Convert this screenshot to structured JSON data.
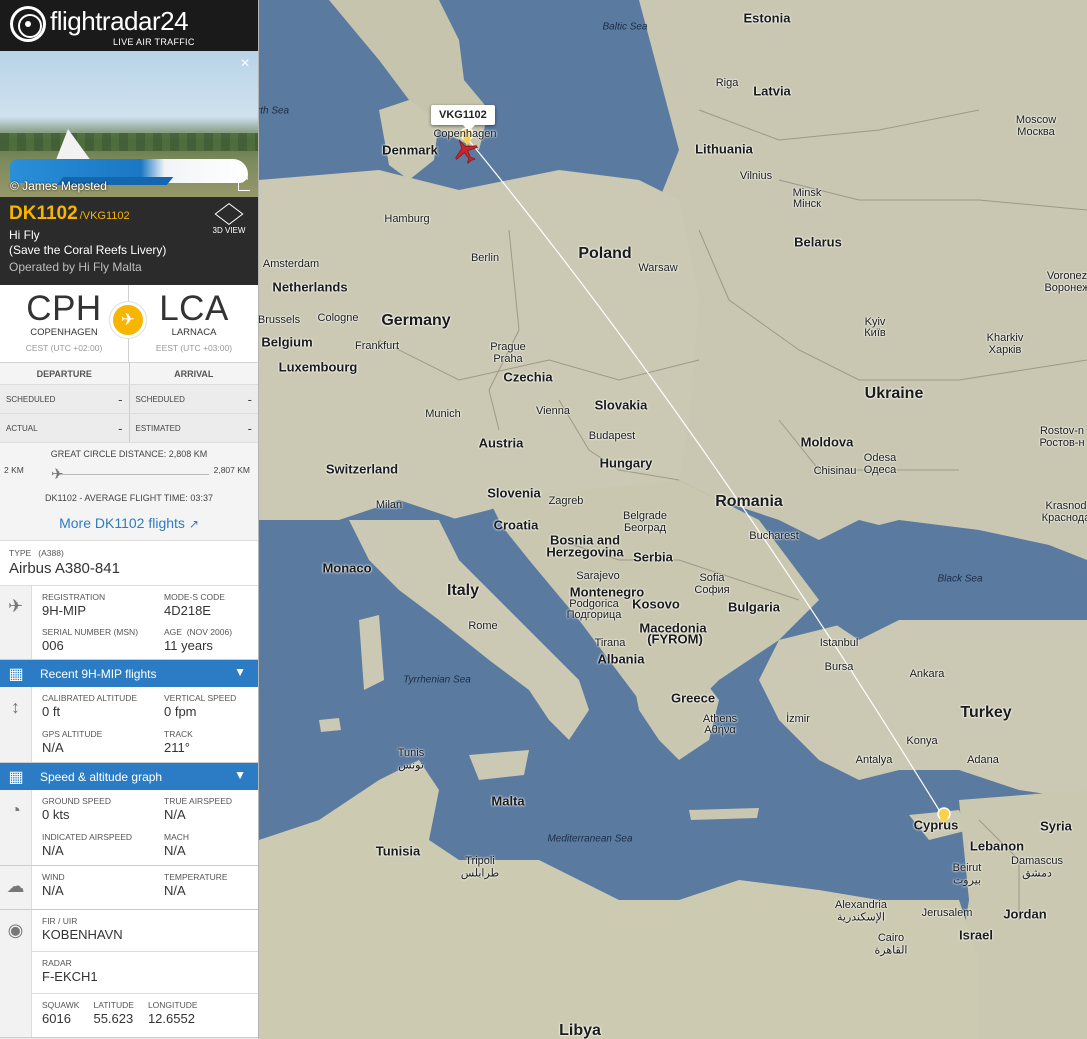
{
  "logo": {
    "brand": "flightradar24",
    "tagline": "LIVE AIR TRAFFIC"
  },
  "photo": {
    "credit": "© James Mepsted",
    "close": "×"
  },
  "flight": {
    "number": "DK1102",
    "callsign": "/VKG1102",
    "airline": "Hi Fly",
    "livery": "(Save the Coral Reefs Livery)",
    "operated_by": "Operated by Hi Fly Malta",
    "view_3d": "3D VIEW"
  },
  "route": {
    "origin": {
      "iata": "CPH",
      "city": "COPENHAGEN",
      "tz": "CEST (UTC +02:00)"
    },
    "destination": {
      "iata": "LCA",
      "city": "LARNACA",
      "tz": "EEST (UTC +03:00)"
    }
  },
  "times": {
    "departure_header": "DEPARTURE",
    "arrival_header": "ARRIVAL",
    "scheduled_label": "SCHEDULED",
    "actual_label": "ACTUAL",
    "estimated_label": "ESTIMATED",
    "dep_scheduled": "-",
    "arr_scheduled": "-",
    "dep_actual": "-",
    "arr_estimated": "-"
  },
  "distance": {
    "label": "GREAT CIRCLE DISTANCE: 2,808 KM",
    "flown": "2 KM",
    "remaining": "2,807 KM",
    "avg_time": "DK1102 - AVERAGE FLIGHT TIME: 03:37",
    "more_flights": "More DK1102 flights",
    "progress": 0.001
  },
  "aircraft": {
    "type_label": "TYPE",
    "type_code": "(A388)",
    "type_name": "Airbus A380-841",
    "registration_label": "REGISTRATION",
    "registration": "9H-MIP",
    "modes_label": "MODE-S CODE",
    "modes": "4D218E",
    "serial_label": "SERIAL NUMBER (MSN)",
    "serial": "006",
    "age_label": "AGE",
    "age_date": "(NOV 2006)",
    "age": "11 years"
  },
  "sections": {
    "recent_flights": "Recent 9H-MIP flights",
    "speed_graph": "Speed & altitude graph"
  },
  "altitude": {
    "cal_alt_label": "CALIBRATED ALTITUDE",
    "cal_alt": "0 ft",
    "vs_label": "VERTICAL SPEED",
    "vs": "0 fpm",
    "gps_label": "GPS ALTITUDE",
    "gps": "N/A",
    "track_label": "TRACK",
    "track": "211°"
  },
  "speed": {
    "gs_label": "GROUND SPEED",
    "gs": "0 kts",
    "tas_label": "TRUE AIRSPEED",
    "tas": "N/A",
    "ias_label": "INDICATED AIRSPEED",
    "ias": "N/A",
    "mach_label": "MACH",
    "mach": "N/A"
  },
  "weather": {
    "wind_label": "WIND",
    "wind": "N/A",
    "temp_label": "TEMPERATURE",
    "temp": "N/A"
  },
  "position": {
    "fir_label": "FIR / UIR",
    "fir": "KOBENHAVN",
    "radar_label": "RADAR",
    "radar": "F-EKCH1",
    "squawk_label": "SQUAWK",
    "squawk": "6016",
    "lat_label": "LATITUDE",
    "lat": "55.623",
    "lon_label": "LONGITUDE",
    "lon": "12.6552"
  },
  "map": {
    "callsign_tag": "VKG1102",
    "labels": {
      "estonia": "Estonia",
      "baltic": "Baltic Sea",
      "riga": "Riga",
      "latvia": "Latvia",
      "north_sea": "rth Sea",
      "denmark": "Denmark",
      "copenhagen": "Copenhagen",
      "lithuania": "Lithuania",
      "moscow": "Moscow",
      "moscow_ru": "Москва",
      "vilnius": "Vilnius",
      "minsk": "Minsk",
      "minsk_by": "Мінск",
      "hamburg": "Hamburg",
      "belarus": "Belarus",
      "amsterdam": "Amsterdam",
      "berlin": "Berlin",
      "poland": "Poland",
      "warsaw": "Warsaw",
      "netherlands": "Netherlands",
      "voronezh": "Voronez",
      "voronezh_ru": "Воронеж",
      "brussels": "Brussels",
      "cologne": "Cologne",
      "germany": "Germany",
      "kyiv": "Kyiv",
      "kyiv_ua": "Київ",
      "belgium": "Belgium",
      "frankfurt": "Frankfurt",
      "kharkiv": "Kharkiv",
      "kharkiv_ua": "Харків",
      "prague": "Prague",
      "praha": "Praha",
      "luxembourg": "Luxembourg",
      "czechia": "Czechia",
      "ukraine": "Ukraine",
      "rostov": "Rostov-n",
      "rostov_ru": "Ростов-н",
      "slovakia": "Slovakia",
      "munich": "Munich",
      "vienna": "Vienna",
      "austria": "Austria",
      "budapest": "Budapest",
      "moldova": "Moldova",
      "chisinau": "Chisinau",
      "odesa": "Odesa",
      "odesa_ua": "Одеса",
      "hungary": "Hungary",
      "switzerland": "Switzerland",
      "milan": "Milan",
      "slovenia": "Slovenia",
      "zagreb": "Zagreb",
      "romania": "Romania",
      "krasnodar": "Krasnod",
      "krasnodar_ru": "Краснода",
      "croatia": "Croatia",
      "belgrade": "Belgrade",
      "beograd": "Београд",
      "bosnia1": "Bosnia and",
      "bosnia2": "Herzegovina",
      "bucharest": "Bucharest",
      "serbia": "Serbia",
      "sarajevo": "Sarajevo",
      "monaco": "Monaco",
      "italy": "Italy",
      "sofia": "Sofia",
      "sofia_bg": "София",
      "montenegro": "Montenegro",
      "podgorica": "Podgorica",
      "podgorica_me": "Подгорица",
      "kosovo": "Kosovo",
      "bulgaria": "Bulgaria",
      "rome": "Rome",
      "black_sea": "Black Sea",
      "macedonia": "Macedonia",
      "fyrom": "(FYROM)",
      "tirana": "Tirana",
      "istanbul": "Istanbul",
      "albania": "Albania",
      "bursa": "Bursa",
      "ankara": "Ankara",
      "tyrrhenian": "Tyrrhenian Sea",
      "greece": "Greece",
      "turkey": "Turkey",
      "izmir": "İzmir",
      "athens": "Athens",
      "athens_gr": "Αθήνα",
      "tunis": "Tunis",
      "tunis_ar": "تونس",
      "konya": "Konya",
      "antalya": "Antalya",
      "adana": "Adana",
      "malta": "Malta",
      "cyprus": "Cyprus",
      "syria": "Syria",
      "mediterranean": "Mediterranean Sea",
      "tunisia": "Tunisia",
      "lebanon": "Lebanon",
      "damascus": "Damascus",
      "damascus_ar": "دمشق",
      "tripoli": "Tripoli",
      "tripoli_ar": "طرابلس",
      "beirut": "Beirut",
      "beirut_ar": "بيروت",
      "alexandria": "Alexandria",
      "alexandria_ar": "الإسكندرية",
      "jerusalem": "Jerusalem",
      "jordan": "Jordan",
      "israel": "Israel",
      "cairo": "Cairo",
      "cairo_ar": "القاهرة",
      "libya": "Libya"
    }
  },
  "colors": {
    "accent_yellow": "#f7b500",
    "section_blue": "#2b7cc4",
    "sea": "#5a7aa0",
    "land": "#c8c6b0",
    "aircraft_red": "#c8242c"
  }
}
